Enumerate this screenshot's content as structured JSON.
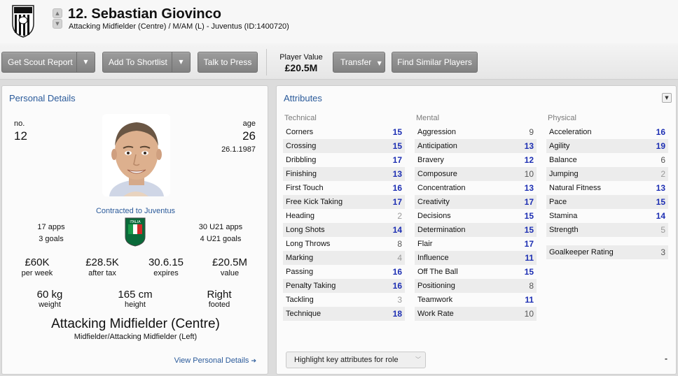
{
  "header": {
    "name": "12. Sebastian Giovinco",
    "subtitle": "Attacking Midfielder (Centre) / M/AM (L) - Juventus (ID:1400720)"
  },
  "toolbar": {
    "scout_report": "Get Scout Report",
    "shortlist": "Add To Shortlist",
    "talk_press": "Talk to Press",
    "player_value_label": "Player Value",
    "player_value": "£20.5M",
    "transfer": "Transfer",
    "find_similar": "Find Similar Players"
  },
  "personal": {
    "title": "Personal Details",
    "no_label": "no.",
    "no_value": "12",
    "age_label": "age",
    "age_value": "26",
    "dob": "26.1.1987",
    "contract": "Contracted to Juventus",
    "apps": "17 apps",
    "goals": "3 goals",
    "u21_apps": "30 U21 apps",
    "u21_goals": "4 U21 goals",
    "wage": "£60K",
    "wage_label": "per week",
    "after_tax": "£28.5K",
    "after_tax_label": "after tax",
    "expires": "30.6.15",
    "expires_label": "expires",
    "value": "£20.5M",
    "value_label": "value",
    "weight": "60 kg",
    "weight_label": "weight",
    "height": "165 cm",
    "height_label": "height",
    "foot": "Right",
    "foot_label": "footed",
    "position": "Attacking Midfielder (Centre)",
    "position_sub": "Midfielder/Attacking Midfielder (Left)",
    "view_link": "View Personal Details",
    "flag_text": "ITALIA"
  },
  "attributes": {
    "title": "Attributes",
    "technical_head": "Technical",
    "mental_head": "Mental",
    "physical_head": "Physical",
    "technical": [
      {
        "name": "Corners",
        "value": 15
      },
      {
        "name": "Crossing",
        "value": 15
      },
      {
        "name": "Dribbling",
        "value": 17
      },
      {
        "name": "Finishing",
        "value": 13
      },
      {
        "name": "First Touch",
        "value": 16
      },
      {
        "name": "Free Kick Taking",
        "value": 17
      },
      {
        "name": "Heading",
        "value": 2
      },
      {
        "name": "Long Shots",
        "value": 14
      },
      {
        "name": "Long Throws",
        "value": 8
      },
      {
        "name": "Marking",
        "value": 4
      },
      {
        "name": "Passing",
        "value": 16
      },
      {
        "name": "Penalty Taking",
        "value": 16
      },
      {
        "name": "Tackling",
        "value": 3
      },
      {
        "name": "Technique",
        "value": 18
      }
    ],
    "mental": [
      {
        "name": "Aggression",
        "value": 9
      },
      {
        "name": "Anticipation",
        "value": 13
      },
      {
        "name": "Bravery",
        "value": 12
      },
      {
        "name": "Composure",
        "value": 10
      },
      {
        "name": "Concentration",
        "value": 13
      },
      {
        "name": "Creativity",
        "value": 17
      },
      {
        "name": "Decisions",
        "value": 15
      },
      {
        "name": "Determination",
        "value": 15
      },
      {
        "name": "Flair",
        "value": 17
      },
      {
        "name": "Influence",
        "value": 11
      },
      {
        "name": "Off The Ball",
        "value": 15
      },
      {
        "name": "Positioning",
        "value": 8
      },
      {
        "name": "Teamwork",
        "value": 11
      },
      {
        "name": "Work Rate",
        "value": 10
      }
    ],
    "physical": [
      {
        "name": "Acceleration",
        "value": 16
      },
      {
        "name": "Agility",
        "value": 19
      },
      {
        "name": "Balance",
        "value": 6
      },
      {
        "name": "Jumping",
        "value": 2
      },
      {
        "name": "Natural Fitness",
        "value": 13
      },
      {
        "name": "Pace",
        "value": 15
      },
      {
        "name": "Stamina",
        "value": 14
      },
      {
        "name": "Strength",
        "value": 5
      }
    ],
    "goalkeeper": {
      "name": "Goalkeeper Rating",
      "value": 3
    },
    "highlight_label": "Highlight key attributes for role",
    "dash": "-"
  }
}
